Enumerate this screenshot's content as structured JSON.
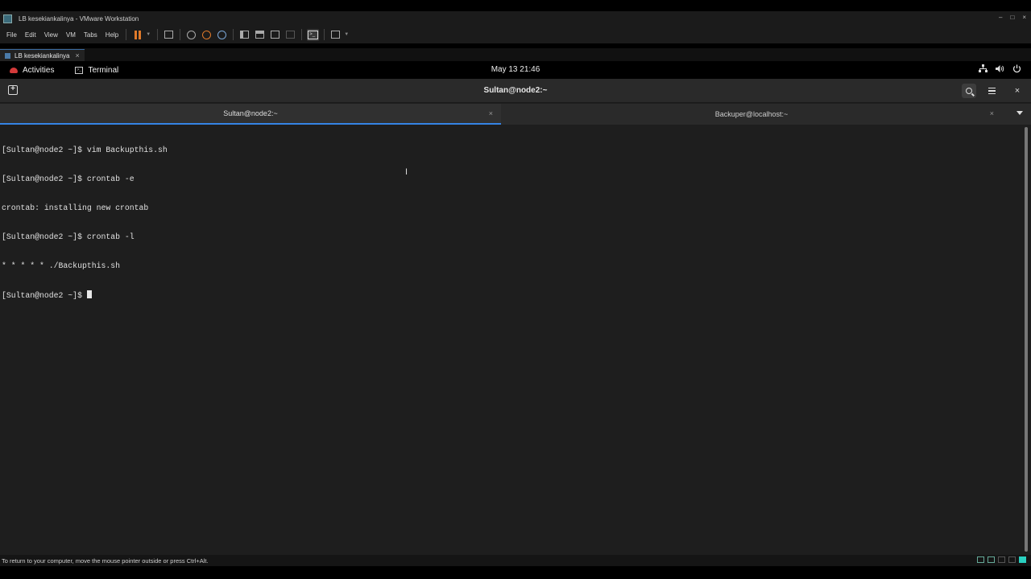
{
  "vmware": {
    "window_title": "LB kesekiankalinya - VMware Workstation",
    "menu": [
      "File",
      "Edit",
      "View",
      "VM",
      "Tabs",
      "Help"
    ],
    "vm_tab_label": "LB kesekiankalinya",
    "vm_tab_close": "×",
    "status_text": "To return to your computer, move the mouse pointer outside or press Ctrl+Alt."
  },
  "gnome": {
    "activities": "Activities",
    "app_name": "Terminal",
    "clock": "May 13  21:46"
  },
  "terminal": {
    "title": "Sultan@node2:~",
    "tabs": [
      {
        "label": "Sultan@node2:~",
        "close": "×",
        "active": true
      },
      {
        "label": "Backuper@localhost:~",
        "close": "×",
        "active": false
      }
    ],
    "lines": [
      "[Sultan@node2 ~]$ vim Backupthis.sh",
      "[Sultan@node2 ~]$ crontab -e",
      "crontab: installing new crontab",
      "[Sultan@node2 ~]$ crontab -l",
      "* * * * * ./Backupthis.sh",
      "[Sultan@node2 ~]$ "
    ]
  },
  "icons": {
    "close": "×",
    "window_controls": [
      "–",
      "□",
      "×"
    ]
  },
  "colors": {
    "accent_tab_underline": "#3584e4",
    "vm_pause": "#e07a2a",
    "terminal_bg": "#1e1e1e"
  }
}
